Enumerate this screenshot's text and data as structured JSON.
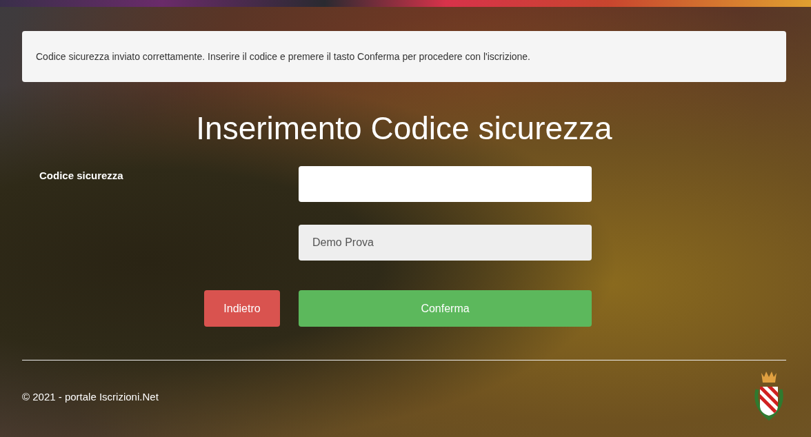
{
  "alert": {
    "text": "Codice sicurezza inviato correttamente. Inserire il codice e premere il tasto Conferma per procedere con l'iscrizione."
  },
  "title": "Inserimento Codice sicurezza",
  "fields": [
    {
      "label": "Codice sicurezza",
      "disabled": false
    },
    {
      "value": "Demo Prova",
      "disabled": true
    }
  ],
  "buttons": [
    {
      "label": "Indietro",
      "kind": "danger"
    },
    {
      "label": "Conferma",
      "kind": "success"
    }
  ],
  "footer": {
    "text": "© 2021 - portale Iscrizioni.Net"
  }
}
